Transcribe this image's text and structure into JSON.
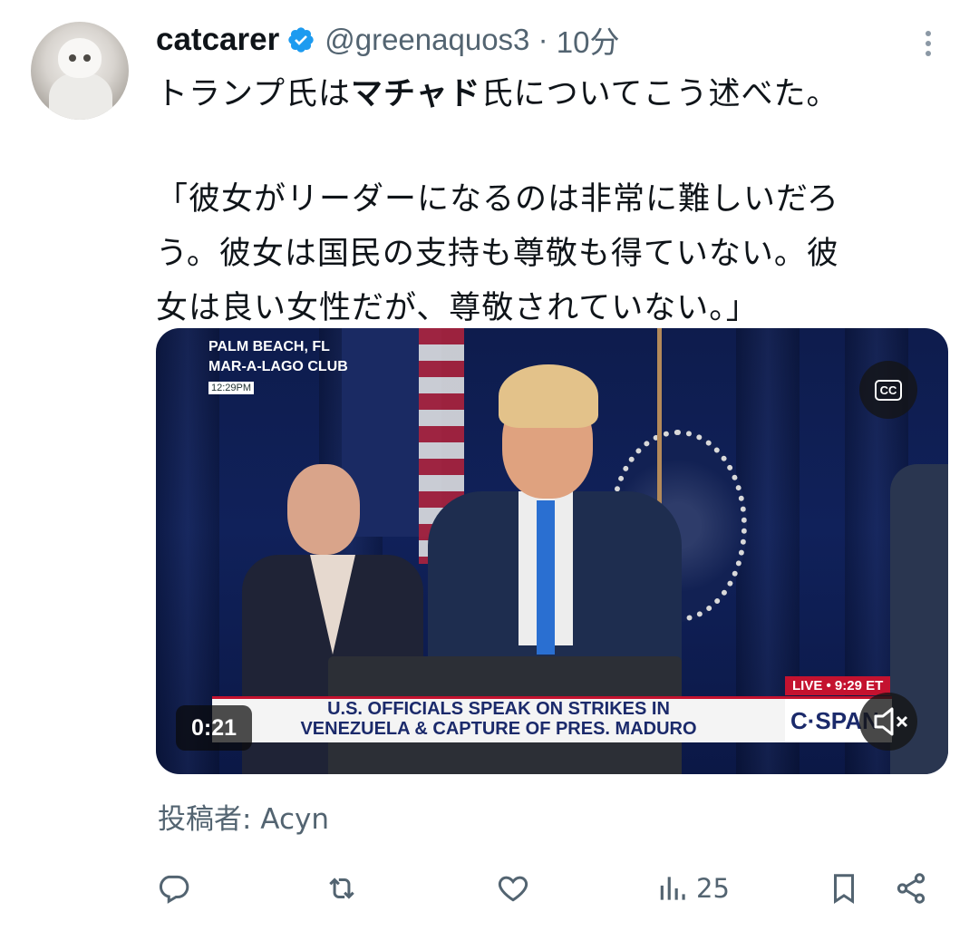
{
  "tweet": {
    "author": {
      "display_name": "catcarer",
      "handle": "@greenaquos3",
      "time": "10分",
      "verified": true
    },
    "text": {
      "line1_prefix": "トランプ氏は",
      "line1_bold": "マチャド",
      "line1_suffix": "氏についてこう述べた。",
      "quote_line1": "「彼女がリーダーになるのは非常に難しいだろ",
      "quote_line2": "う。彼女は国民の支持も尊敬も得ていない。彼",
      "quote_line3": "女は良い女性だが、尊敬されていない。」"
    },
    "video": {
      "location_line1": "PALM BEACH, FL",
      "location_line2": "MAR-A-LAGO CLUB",
      "location_time": "12:29PM",
      "cc_label": "CC",
      "live_label": "LIVE • 9:29 ET",
      "headline_line1": "U.S. OFFICIALS SPEAK ON STRIKES IN",
      "headline_line2": "VENEZUELA & CAPTURE OF PRES. MADURO",
      "network_logo": "C·SPAN",
      "timestamp": "0:21",
      "muted": true
    },
    "attribution": "投稿者: Acyn",
    "actions": {
      "reply_icon": "reply-icon",
      "retweet_icon": "retweet-icon",
      "like_icon": "heart-icon",
      "views_icon": "views-icon",
      "views_count": "25",
      "bookmark_icon": "bookmark-icon",
      "share_icon": "share-icon"
    }
  },
  "colors": {
    "text_primary": "#0f1419",
    "text_secondary": "#536471",
    "verified_blue": "#1d9bf0",
    "live_red": "#c4122f"
  }
}
